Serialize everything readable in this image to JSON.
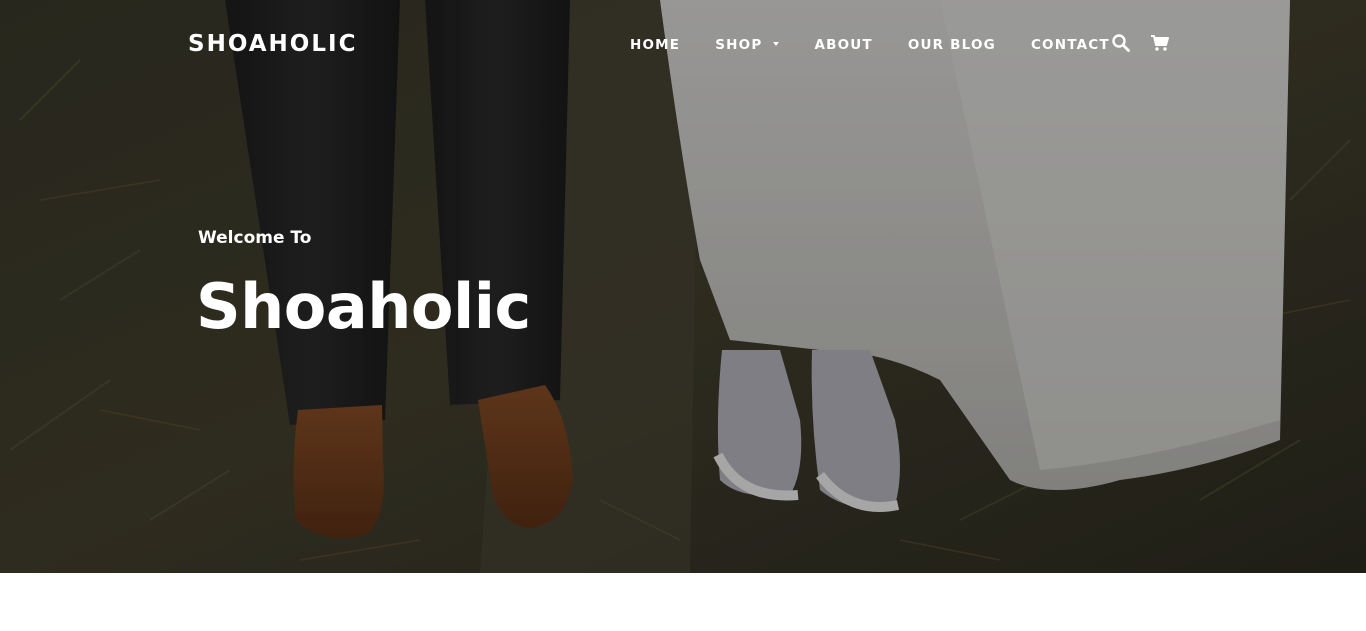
{
  "header": {
    "brand": "SHOAHOLIC",
    "nav": [
      {
        "label": "HOME"
      },
      {
        "label": "SHOP"
      },
      {
        "label": "ABOUT"
      },
      {
        "label": "OUR BLOG"
      },
      {
        "label": "CONTACT"
      }
    ],
    "icons": {
      "search": "search-icon",
      "cart": "cart-icon"
    }
  },
  "hero": {
    "kicker": "Welcome To",
    "title": "Shoaholic",
    "image": "photo of groom in dark trousers and brown shoes beside bride in white lace dress and white sneakers on grass"
  },
  "colors": {
    "text": "#ffffff",
    "page_background": "#ffffff"
  }
}
